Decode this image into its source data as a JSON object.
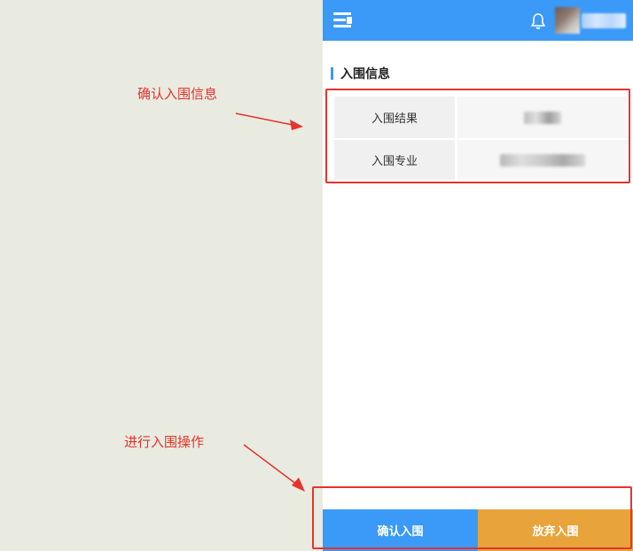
{
  "annotations": {
    "confirm_info_note": "确认入围信息",
    "action_note": "进行入围操作"
  },
  "header": {
    "menu_icon": "menu-icon",
    "bell_icon": "bell-icon"
  },
  "section": {
    "title": "入围信息"
  },
  "info_table": {
    "rows": [
      {
        "label": "入围结果"
      },
      {
        "label": "入围专业"
      }
    ]
  },
  "actions": {
    "confirm_label": "确认入围",
    "give_up_label": "放弃入围"
  },
  "colors": {
    "primary": "#3b9af7",
    "secondary": "#e8a43a",
    "annotation": "#e8322e",
    "background": "#e9ebe0"
  }
}
